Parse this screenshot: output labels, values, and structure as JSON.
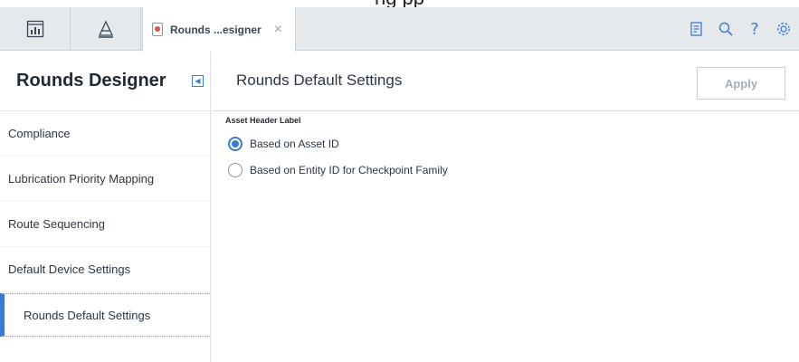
{
  "header_strip": {
    "text": "ng   pp"
  },
  "tabs": {
    "active_label": "Rounds ...esigner",
    "close_symbol": "×"
  },
  "toolbar": {
    "help_symbol": "?"
  },
  "sidebar": {
    "title": "Rounds Designer",
    "items": [
      {
        "label": "Compliance"
      },
      {
        "label": "Lubrication Priority Mapping"
      },
      {
        "label": "Route Sequencing"
      },
      {
        "label": "Default Device Settings"
      },
      {
        "label": "Rounds Default Settings"
      }
    ],
    "active_index": 4
  },
  "main": {
    "title": "Rounds Default Settings",
    "apply_label": "Apply",
    "section_label": "Asset Header Label",
    "options": [
      {
        "label": "Based on Asset ID",
        "checked": true
      },
      {
        "label": "Based on Entity ID for Checkpoint Family",
        "checked": false
      }
    ]
  },
  "colors": {
    "accent": "#3a7bd5",
    "tabbar_bg": "#e6e9ec",
    "badge_red": "#d9534f"
  }
}
